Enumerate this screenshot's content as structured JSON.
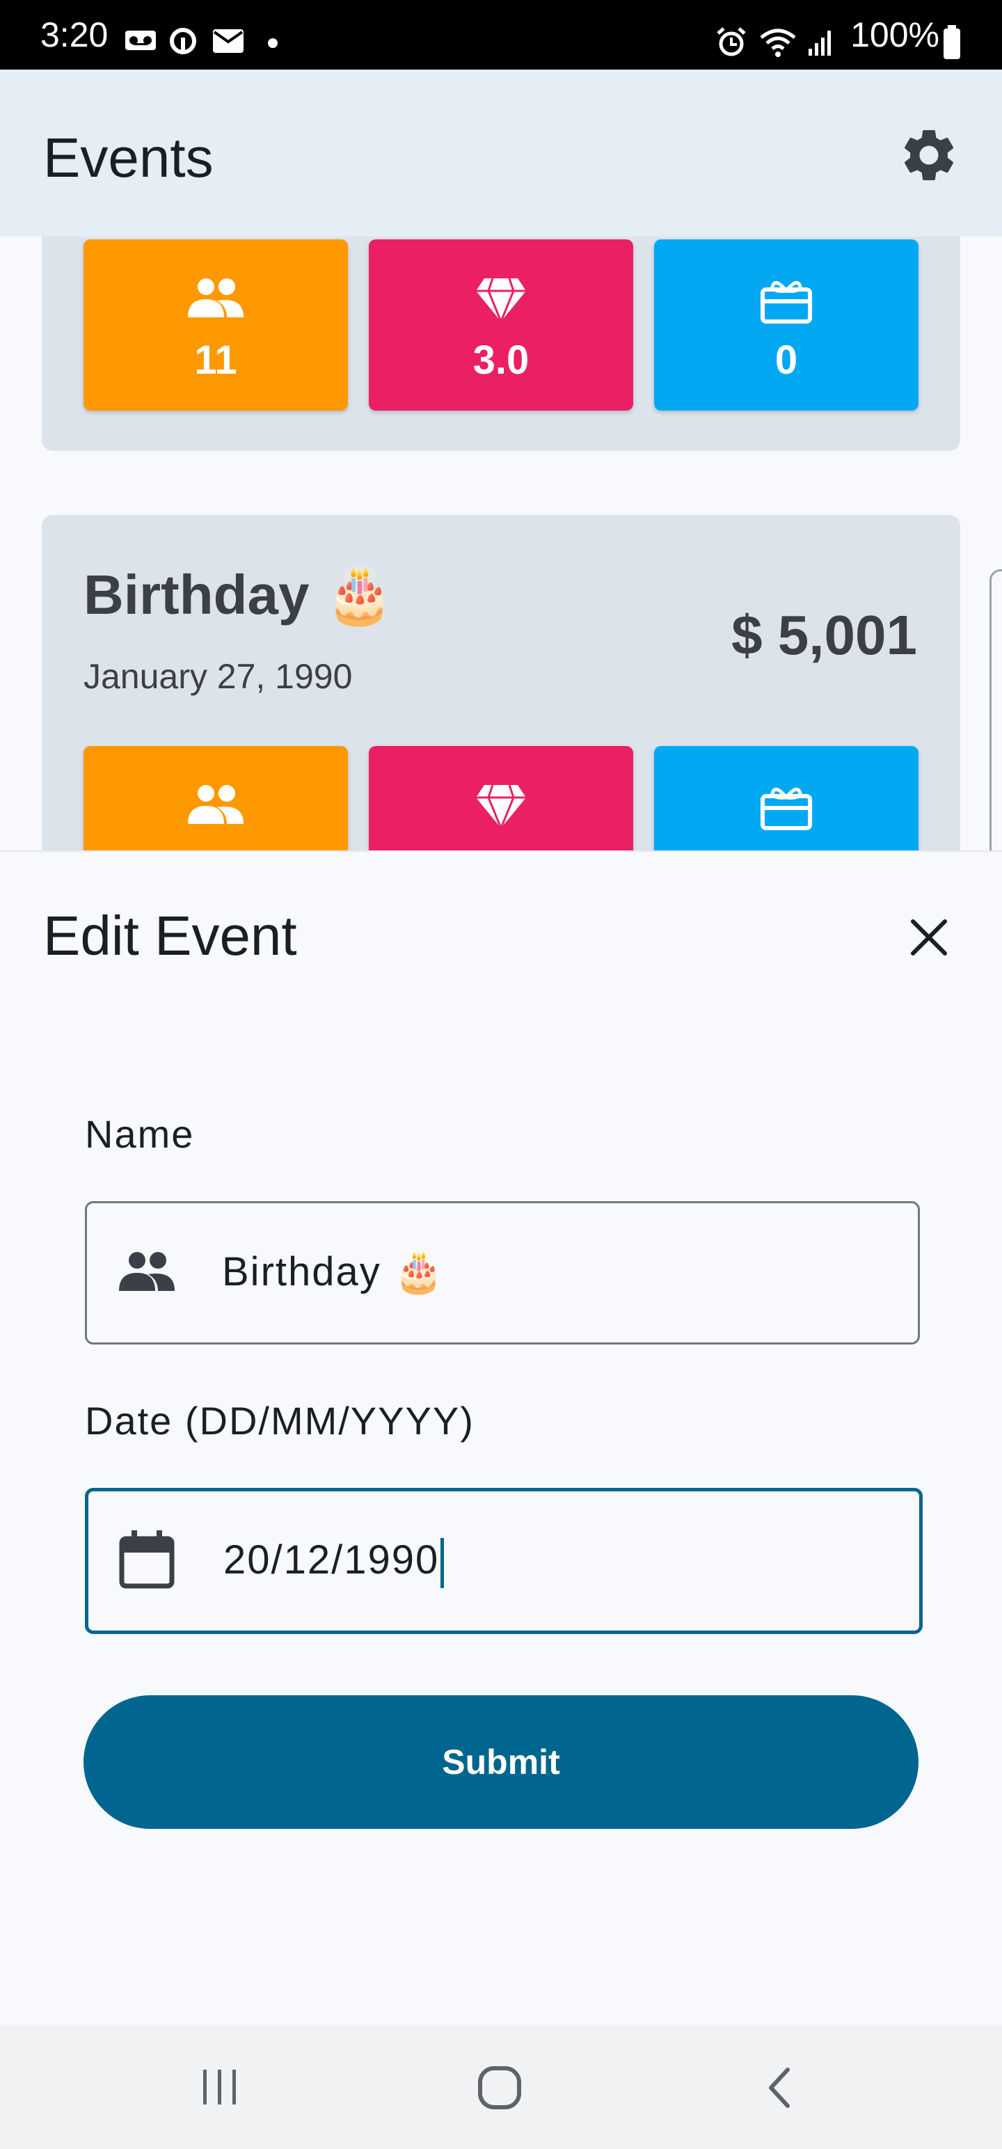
{
  "status_bar": {
    "time": "3:20",
    "battery": "100%",
    "icons": [
      "voicemail-icon",
      "data-saver-icon",
      "mail-icon",
      "dot-icon",
      "alarm-icon",
      "wifi-icon",
      "signal-icon",
      "battery-icon"
    ]
  },
  "app_bar": {
    "title": "Events",
    "settings_icon": "gear-icon"
  },
  "cards": [
    {
      "stats": {
        "guests": "11",
        "rating": "3.0",
        "gifts": "0"
      }
    },
    {
      "name": "Birthday 🎂",
      "date": "January 27, 1990",
      "amount": "$ 5,001"
    }
  ],
  "sheet": {
    "title": "Edit Event",
    "close_icon": "close-icon",
    "name_label": "Name",
    "name_value": "Birthday 🎂",
    "date_label": "Date (DD/MM/YYYY)",
    "date_value": "20/12/1990",
    "submit_label": "Submit"
  },
  "colors": {
    "orange": "#fe9800",
    "pink": "#eb1f63",
    "blue": "#03a8f3",
    "primary": "#00658f",
    "card_bg": "#dce3ea",
    "appbar_bg": "#e4eef4"
  },
  "nav_bar": {
    "icons": [
      "recents-icon",
      "home-icon",
      "back-icon"
    ]
  }
}
